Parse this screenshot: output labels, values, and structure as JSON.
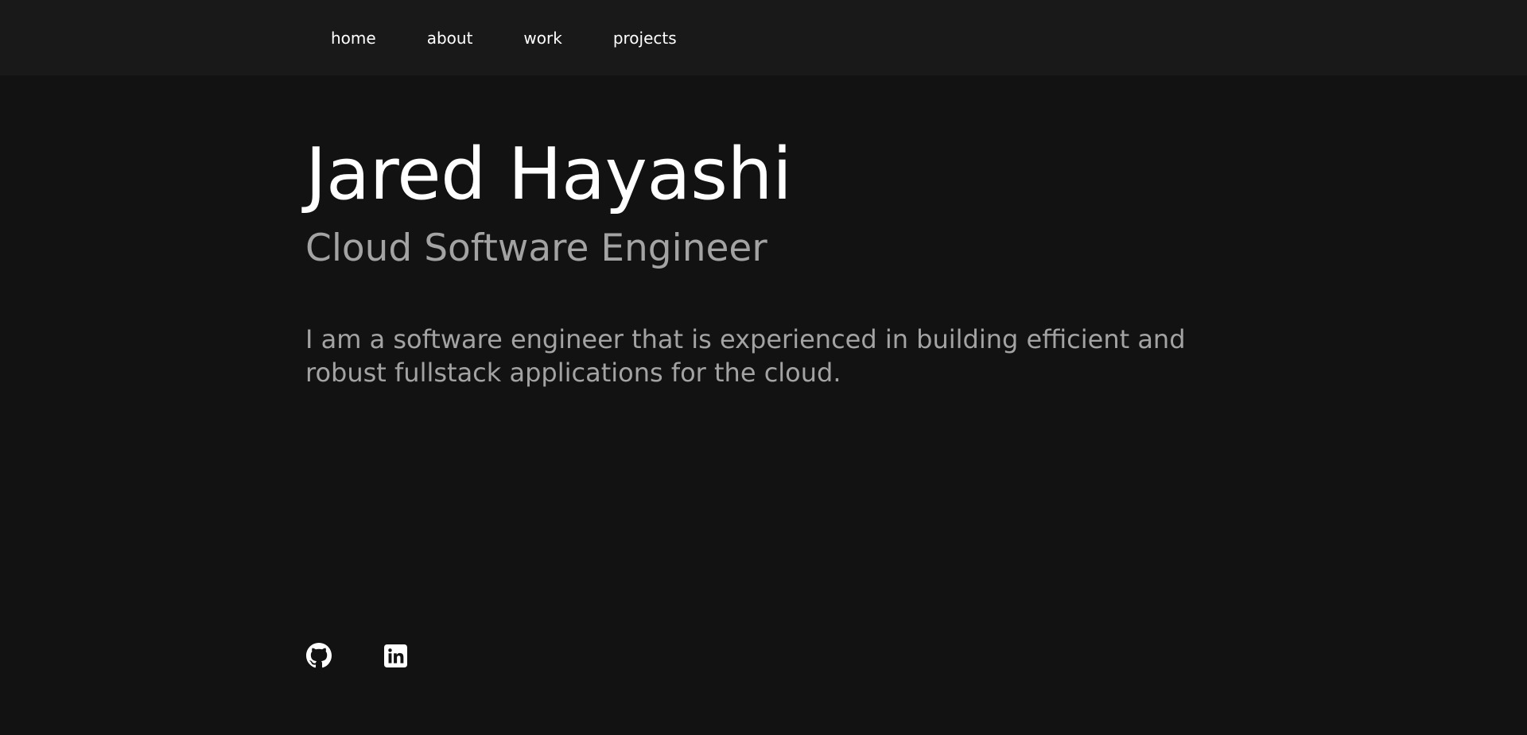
{
  "nav": {
    "items": [
      {
        "label": "home"
      },
      {
        "label": "about"
      },
      {
        "label": "work"
      },
      {
        "label": "projects"
      }
    ]
  },
  "hero": {
    "name": "Jared Hayashi",
    "role": "Cloud Software Engineer",
    "bio": "I am a software engineer that is experienced in building efficient and robust fullstack applications for the cloud."
  },
  "social": {
    "icons": [
      "github-icon",
      "linkedin-icon"
    ]
  },
  "colors": {
    "page_background": "#121212",
    "nav_background": "#191919",
    "primary_text": "#ffffff",
    "secondary_text": "#a3a3a3"
  }
}
